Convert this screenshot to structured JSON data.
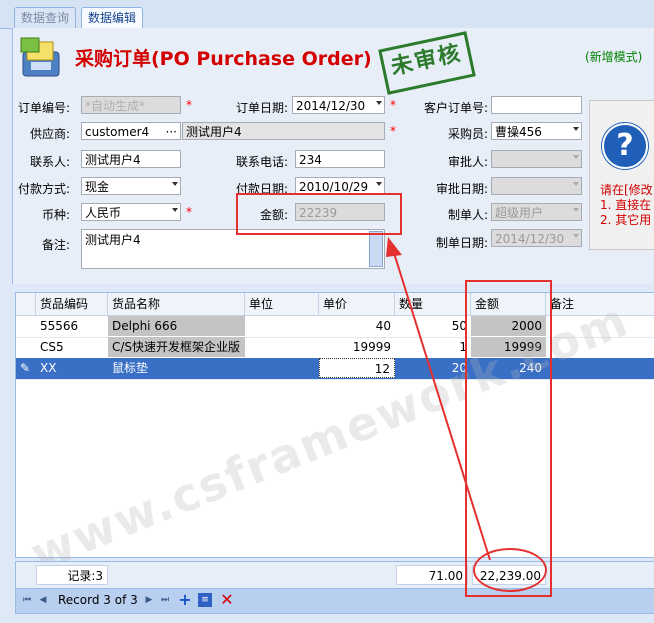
{
  "tabs": [
    {
      "label": "数据查询",
      "active": false
    },
    {
      "label": "数据编辑",
      "active": true
    }
  ],
  "header": {
    "title": "采购订单(PO Purchase Order)",
    "stamp": "未审核",
    "mode": "(新增模式)"
  },
  "form": {
    "order_no": {
      "label": "订单编号:",
      "placeholder": "*自动生成*"
    },
    "order_date": {
      "label": "订单日期:",
      "value": "2014/12/30"
    },
    "customer_order_no": {
      "label": "客户订单号:",
      "value": ""
    },
    "supplier": {
      "label": "供应商:",
      "code": "customer4",
      "name": "测试用户4"
    },
    "purchaser": {
      "label": "采购员:",
      "value": "曹操456"
    },
    "contact": {
      "label": "联系人:",
      "value": "测试用户4"
    },
    "phone": {
      "label": "联系电话:",
      "value": "234"
    },
    "approver": {
      "label": "审批人:",
      "value": ""
    },
    "payment_method": {
      "label": "付款方式:",
      "value": "现金"
    },
    "payment_date": {
      "label": "付款日期:",
      "value": "2010/10/29"
    },
    "approve_date": {
      "label": "审批日期:",
      "value": ""
    },
    "currency": {
      "label": "币种:",
      "value": "人民币"
    },
    "amount": {
      "label": "金额:",
      "value": "22239"
    },
    "creator": {
      "label": "制单人:",
      "value": "超级用户"
    },
    "remark": {
      "label": "备注:",
      "value": "测试用户4"
    },
    "create_date": {
      "label": "制单日期:",
      "value": "2014/12/30"
    }
  },
  "help": {
    "line1": "请在[修改",
    "line2": "1. 直接在",
    "line3": "2. 其它用"
  },
  "grid": {
    "columns": [
      "货品编码",
      "货品名称",
      "单位",
      "单价",
      "数量",
      "金额",
      "备注"
    ],
    "rows": [
      {
        "code": "55566",
        "name": "Delphi 666",
        "unit": "",
        "price": "40",
        "qty": "50",
        "amount": "2000",
        "remark": ""
      },
      {
        "code": "CS5",
        "name": "C/S快速开发框架企业版",
        "unit": "",
        "price": "19999",
        "qty": "1",
        "amount": "19999",
        "remark": ""
      },
      {
        "code": "XX",
        "name": "鼠标垫",
        "unit": "",
        "price": "12",
        "qty": "20",
        "amount": "240",
        "remark": ""
      }
    ]
  },
  "footer": {
    "record_count": "记录:3",
    "qty_total": "71.00",
    "amount_total": "22,239.00"
  },
  "navigator": {
    "record_text": "Record 3 of 3"
  },
  "watermark": "www.csframework.com",
  "colors": {
    "title": "#d40000",
    "mode": "#008000",
    "selection": "#3a6fc6",
    "annotation": "#e53030"
  }
}
